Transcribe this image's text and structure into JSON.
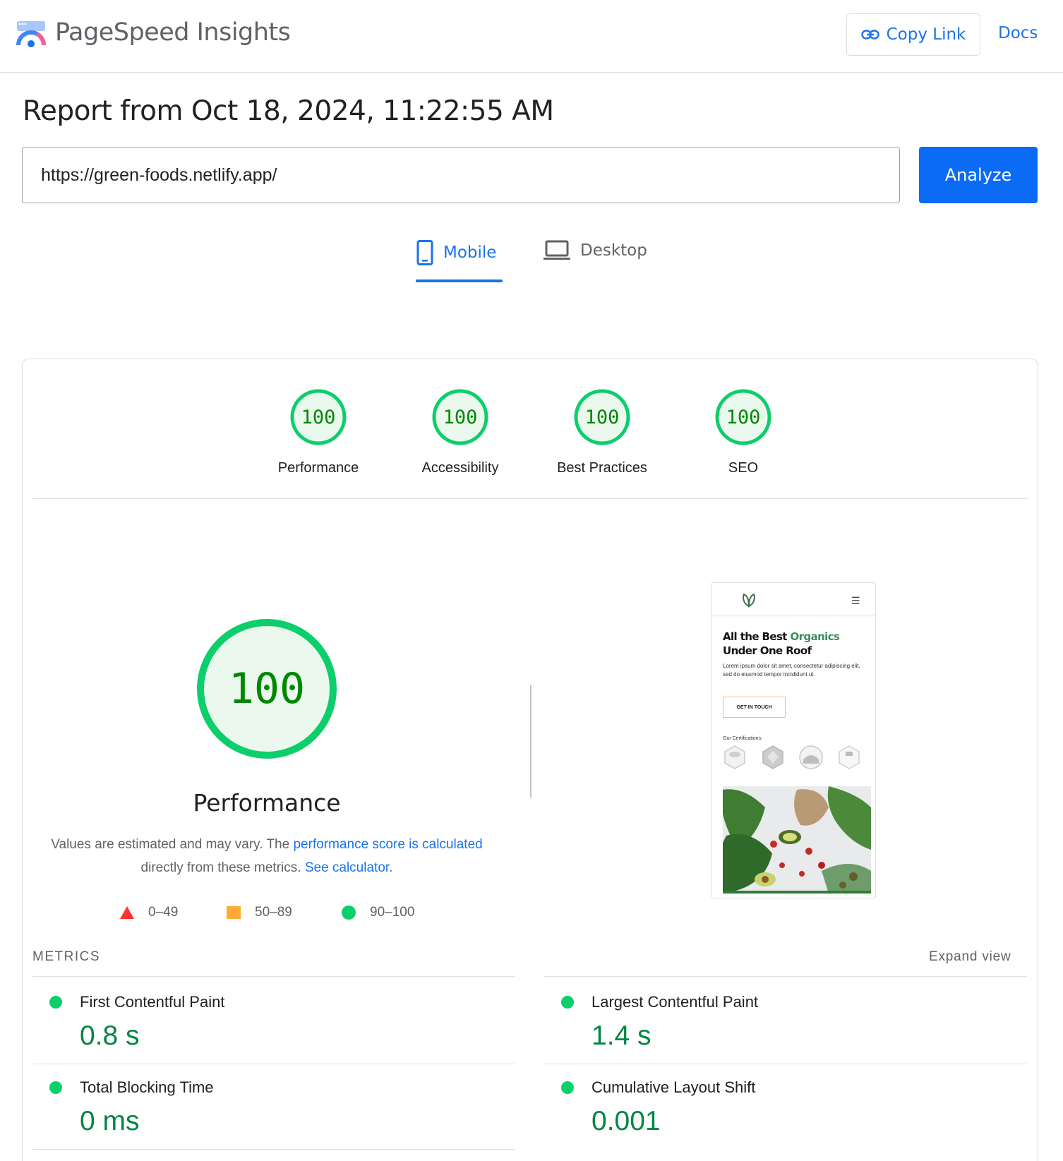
{
  "header": {
    "brand": "PageSpeed Insights",
    "copy_link": "Copy Link",
    "docs": "Docs"
  },
  "report": {
    "title": "Report from Oct 18, 2024, 11:22:55 AM",
    "url": "https://green-foods.netlify.app/",
    "analyze": "Analyze"
  },
  "tabs": [
    {
      "label": "Mobile",
      "icon": "mobile-icon",
      "active": true
    },
    {
      "label": "Desktop",
      "icon": "laptop-icon",
      "active": false
    }
  ],
  "categories": [
    {
      "score": "100",
      "label": "Performance"
    },
    {
      "score": "100",
      "label": "Accessibility"
    },
    {
      "score": "100",
      "label": "Best Practices"
    },
    {
      "score": "100",
      "label": "SEO"
    }
  ],
  "performance": {
    "score": "100",
    "title": "Performance",
    "desc_1": "Values are estimated and may vary. The ",
    "desc_link_1": "performance score is calculated",
    "desc_2": "directly from these metrics. ",
    "desc_link_2": "See calculator."
  },
  "legend": [
    {
      "range": "0–49",
      "shape": "triangle",
      "color": "#ff3333"
    },
    {
      "range": "50–89",
      "shape": "square",
      "color": "#ffaa33"
    },
    {
      "range": "90–100",
      "shape": "circle",
      "color": "#0cce6b"
    }
  ],
  "screenshot": {
    "heading_1": "All the Best ",
    "heading_green": "Organics",
    "heading_2": "Under One Roof",
    "lorem": "Lorem ipsum dolor sit amet, consectetur adipiscing elit, sed do eiusmod tempor incididunt ut.",
    "cta": "GET IN TOUCH",
    "certifications": "Our Certifications:"
  },
  "metrics": {
    "label": "METRICS",
    "expand": "Expand view",
    "items": [
      {
        "name": "First Contentful Paint",
        "value": "0.8 s"
      },
      {
        "name": "Largest Contentful Paint",
        "value": "1.4 s"
      },
      {
        "name": "Total Blocking Time",
        "value": "0 ms"
      },
      {
        "name": "Cumulative Layout Shift",
        "value": "0.001"
      }
    ]
  },
  "colors": {
    "accent": "#1a73e8",
    "pass": "#0cce6b",
    "pass_text": "#008800",
    "analyze_bg": "#0b6bf5"
  }
}
